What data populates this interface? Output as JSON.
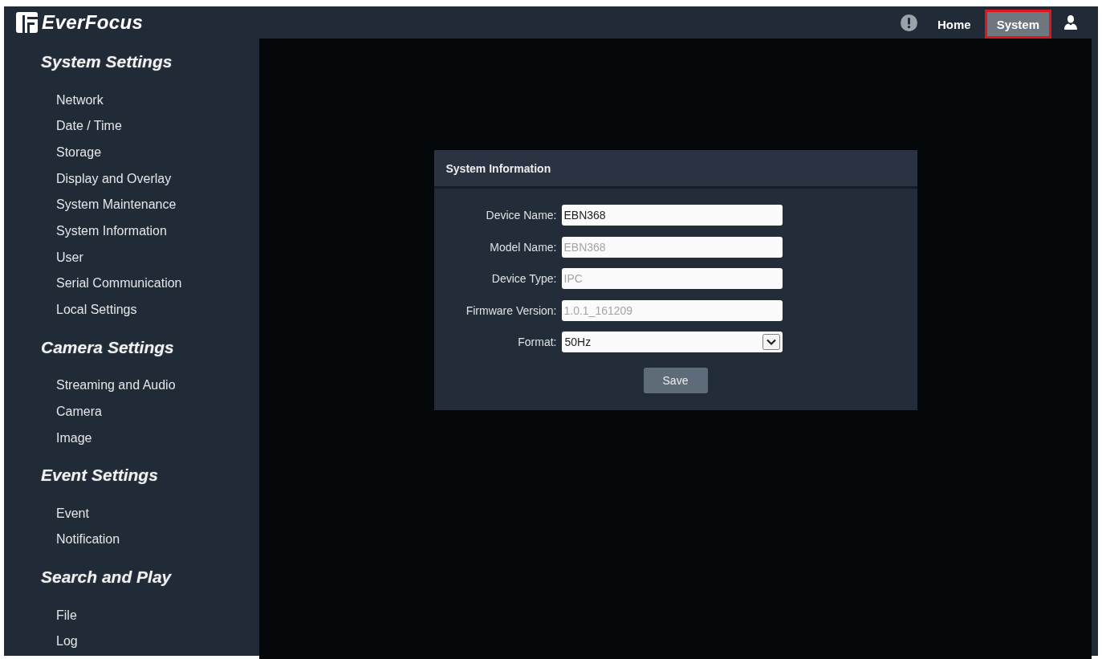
{
  "header": {
    "logo": "EverFocus",
    "tabs": [
      {
        "label": "Home",
        "selected": false
      },
      {
        "label": "System",
        "selected": true
      }
    ]
  },
  "sidebar": {
    "sections": [
      {
        "title": "System Settings",
        "items": [
          "Network",
          "Date / Time",
          "Storage",
          "Display and Overlay",
          "System Maintenance",
          "System Information",
          "User",
          "Serial Communication",
          "Local Settings"
        ]
      },
      {
        "title": "Camera Settings",
        "items": [
          "Streaming and Audio",
          "Camera",
          "Image"
        ]
      },
      {
        "title": "Event Settings",
        "items": [
          "Event",
          "Notification"
        ]
      },
      {
        "title": "Search and Play",
        "items": [
          "File",
          "Log"
        ]
      }
    ]
  },
  "panel": {
    "title": "System Information",
    "fields": [
      {
        "kind": "text",
        "label": "Device Name:",
        "value": "EBN368",
        "disabled": false
      },
      {
        "kind": "text",
        "label": "Model Name:",
        "value": "EBN368",
        "disabled": true
      },
      {
        "kind": "text",
        "label": "Device Type:",
        "value": "IPC",
        "disabled": true
      },
      {
        "kind": "text",
        "label": "Firmware Version:",
        "value": "1.0.1_161209",
        "disabled": true
      },
      {
        "kind": "select",
        "label": "Format:",
        "value": "50Hz",
        "disabled": false
      }
    ],
    "save_button": "Save"
  }
}
